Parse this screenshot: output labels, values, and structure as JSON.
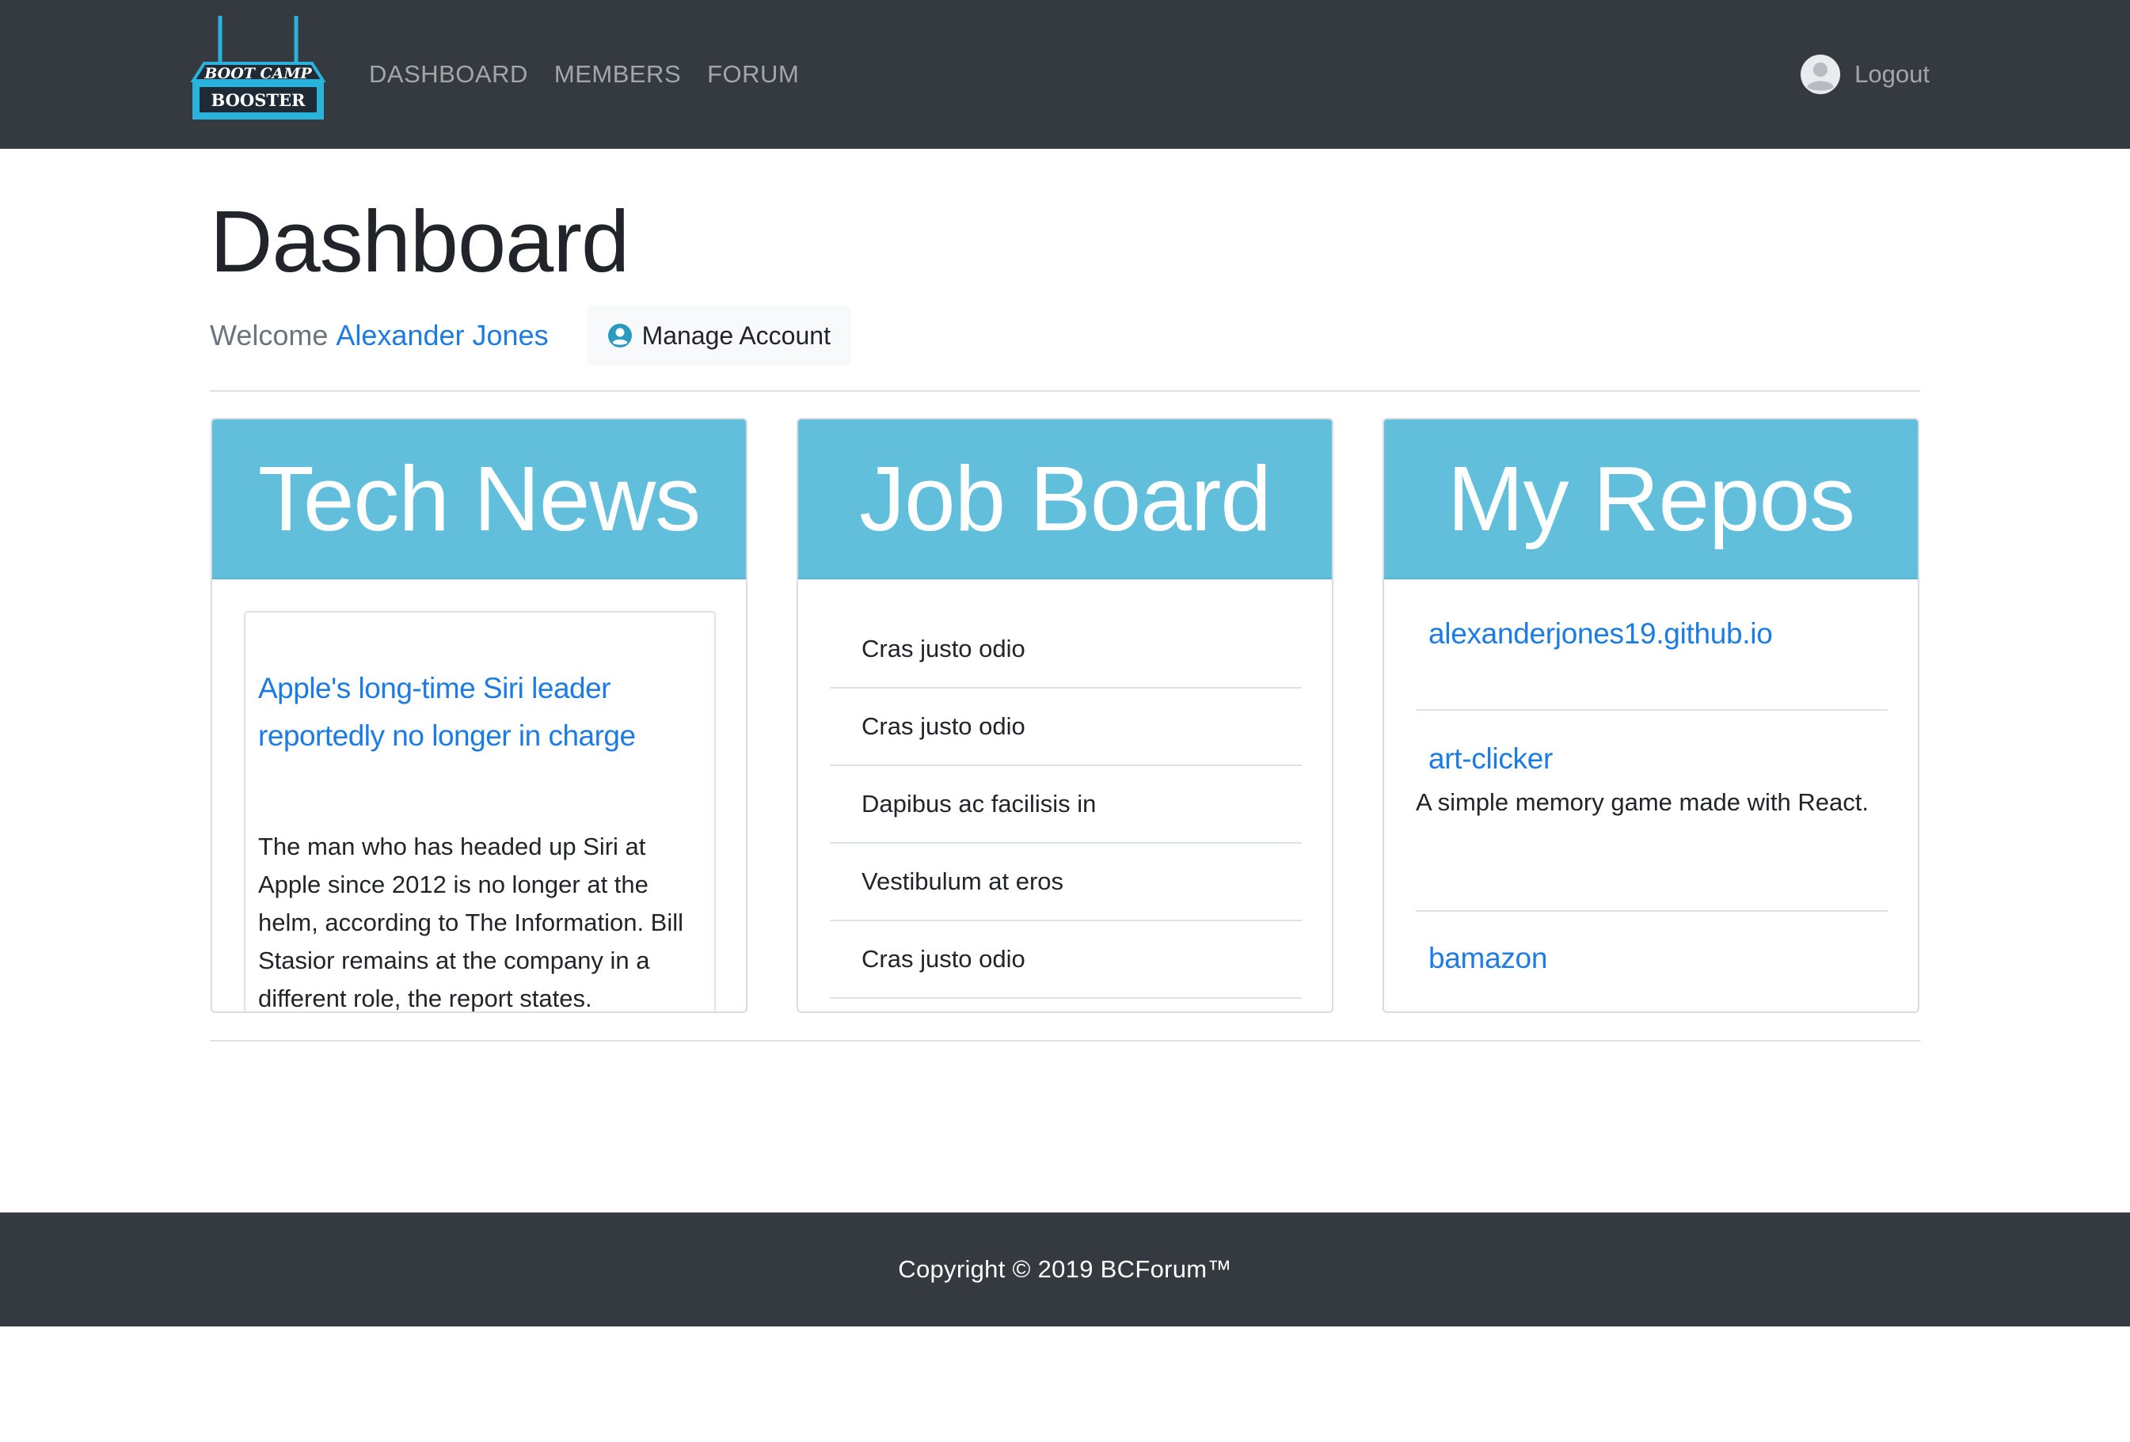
{
  "navbar": {
    "logo": {
      "line1": "BOOT CAMP",
      "line2": "BOOSTER"
    },
    "links": [
      {
        "label": "DASHBOARD"
      },
      {
        "label": "MEMBERS"
      },
      {
        "label": "FORUM"
      }
    ],
    "logout_label": "Logout"
  },
  "header": {
    "title": "Dashboard",
    "welcome_prefix": "Welcome",
    "user_name": "Alexander Jones",
    "manage_account_label": "Manage Account"
  },
  "cards": {
    "tech_news": {
      "title": "Tech News",
      "article": {
        "headline": "Apple's long-time Siri leader reportedly no longer in charge",
        "summary": "The man who has headed up Siri at Apple since 2012 is no longer at the helm, according to The Information. Bill Stasior remains at the company in a different role, the report states."
      }
    },
    "job_board": {
      "title": "Job Board",
      "items": [
        "Cras justo odio",
        "Cras justo odio",
        "Dapibus ac facilisis in",
        "Vestibulum at eros",
        "Cras justo odio"
      ]
    },
    "my_repos": {
      "title": "My Repos",
      "repos": [
        {
          "name": "alexanderjones19.github.io",
          "description": ""
        },
        {
          "name": "art-clicker",
          "description": "A simple memory game made with React."
        },
        {
          "name": "bamazon",
          "description": ""
        }
      ]
    }
  },
  "footer": {
    "copyright": "Copyright © 2019 BCForum™"
  },
  "colors": {
    "navbar_bg": "#343a40",
    "card_header_bg": "#62bfdc",
    "link": "#1d7be6",
    "logo_accent": "#2ab3da"
  },
  "icons": {
    "avatar": "user-avatar-icon",
    "manage": "user-circle-icon"
  }
}
